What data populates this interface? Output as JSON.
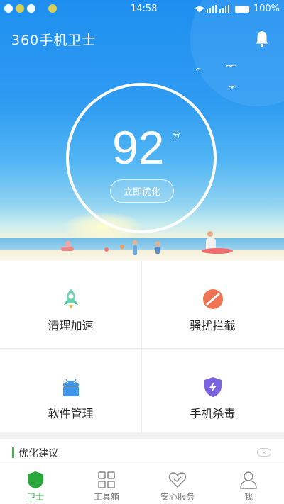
{
  "status_bar": {
    "time": "14:58",
    "battery": "100%"
  },
  "header": {
    "title": "360手机卫士"
  },
  "score": {
    "value": "92",
    "unit": "分",
    "action": "立即优化"
  },
  "features": [
    {
      "label": "清理加速",
      "icon": "rocket-icon"
    },
    {
      "label": "骚扰拦截",
      "icon": "block-icon"
    },
    {
      "label": "软件管理",
      "icon": "android-icon"
    },
    {
      "label": "手机杀毒",
      "icon": "shield-bolt-icon"
    }
  ],
  "suggestion": {
    "title": "优化建议",
    "close": "×"
  },
  "tabs": [
    {
      "label": "卫士",
      "active": true
    },
    {
      "label": "工具箱",
      "active": false
    },
    {
      "label": "安心服务",
      "active": false
    },
    {
      "label": "我",
      "active": false
    }
  ],
  "colors": {
    "accent_green": "#2aa83b",
    "sky_blue": "#1e8ff0"
  }
}
